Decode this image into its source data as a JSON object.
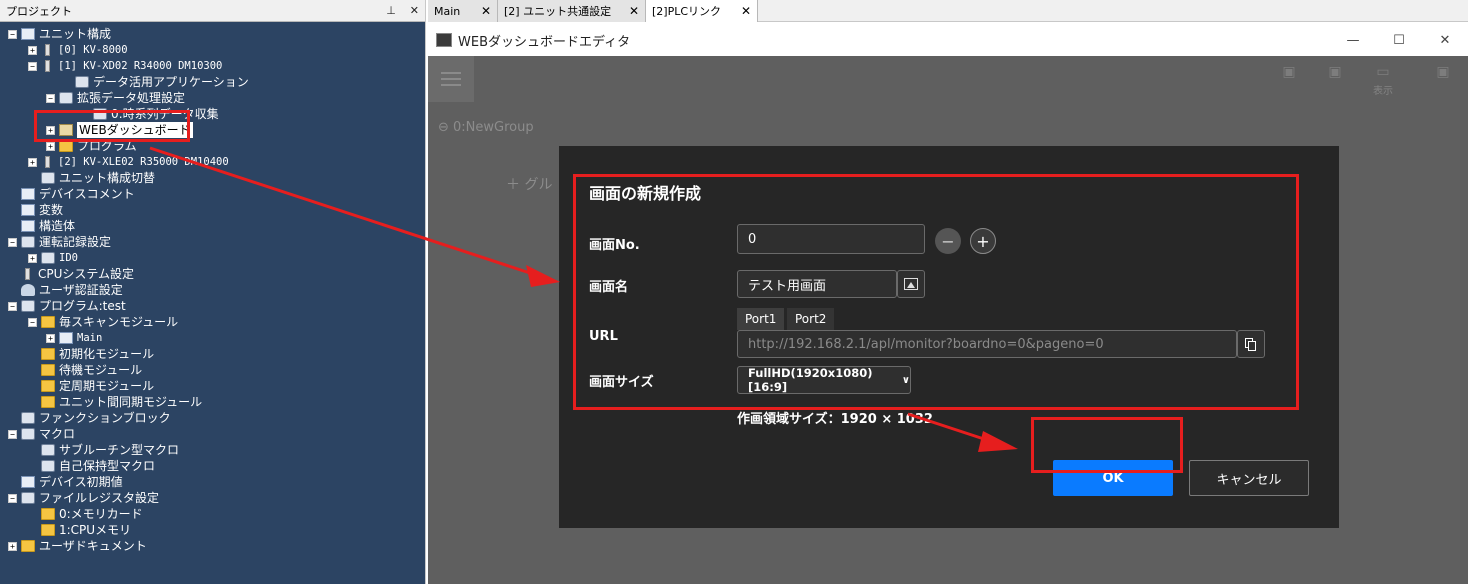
{
  "project_panel": {
    "title": "プロジェクト",
    "pin_icon": "pin-icon",
    "close_icon": "close-icon",
    "tree": [
      {
        "label": "ユニット構成",
        "exp": "-",
        "icon": "unit-config-icon",
        "mono": false
      },
      {
        "label": "[0]  KV-8000",
        "exp": "+",
        "icon": "unit-icon",
        "mono": true
      },
      {
        "label": "[1]  KV-XD02    R34000  DM10300",
        "exp": "-",
        "icon": "unit-icon",
        "mono": true
      },
      {
        "label": "データ活用アプリケーション",
        "exp": "",
        "icon": "gear-icon",
        "mono": false
      },
      {
        "label": "拡張データ処理設定",
        "exp": "-",
        "icon": "gear-icon",
        "mono": false
      },
      {
        "label": "0:時系列データ収集",
        "exp": "",
        "icon": "gear-icon",
        "mono": false
      },
      {
        "label": "WEBダッシュボード",
        "exp": "+",
        "icon": "dashboard-icon",
        "mono": false,
        "highlight": true
      },
      {
        "label": "プログラム",
        "exp": "+",
        "icon": "folder-icon",
        "mono": false
      },
      {
        "label": "[2]  KV-XLE02   R35000  DM10400",
        "exp": "+",
        "icon": "unit-icon",
        "mono": true
      },
      {
        "label": "ユニット構成切替",
        "exp": "",
        "icon": "switch-icon",
        "mono": false
      },
      {
        "label": "デバイスコメント",
        "exp": "",
        "icon": "sheet-icon",
        "mono": false
      },
      {
        "label": "変数",
        "exp": "",
        "icon": "sheet-icon",
        "mono": false
      },
      {
        "label": "構造体",
        "exp": "",
        "icon": "sheet-icon",
        "mono": false
      },
      {
        "label": "運転記録設定",
        "exp": "-",
        "icon": "gear-icon",
        "mono": false
      },
      {
        "label": "ID0",
        "exp": "+",
        "icon": "gear-icon",
        "mono": true
      },
      {
        "label": "CPUシステム設定",
        "exp": "",
        "icon": "unit-icon",
        "mono": false
      },
      {
        "label": "ユーザ認証設定",
        "exp": "",
        "icon": "user-icon",
        "mono": false
      },
      {
        "label": "プログラム:test",
        "exp": "-",
        "icon": "gear-icon",
        "mono": false
      },
      {
        "label": "毎スキャンモジュール",
        "exp": "-",
        "icon": "folder-icon",
        "mono": false
      },
      {
        "label": "Main",
        "exp": "+",
        "icon": "sheet-icon",
        "mono": true
      },
      {
        "label": "初期化モジュール",
        "exp": "",
        "icon": "folder-icon",
        "mono": false
      },
      {
        "label": "待機モジュール",
        "exp": "",
        "icon": "folder-icon",
        "mono": false
      },
      {
        "label": "定周期モジュール",
        "exp": "",
        "icon": "folder-icon",
        "mono": false
      },
      {
        "label": "ユニット間同期モジュール",
        "exp": "",
        "icon": "folder-icon",
        "mono": false
      },
      {
        "label": "ファンクションブロック",
        "exp": "",
        "icon": "gear-icon",
        "mono": false
      },
      {
        "label": "マクロ",
        "exp": "-",
        "icon": "gear-icon",
        "mono": false
      },
      {
        "label": "サブルーチン型マクロ",
        "exp": "",
        "icon": "gear-icon",
        "mono": false
      },
      {
        "label": "自己保持型マクロ",
        "exp": "",
        "icon": "gear-icon",
        "mono": false
      },
      {
        "label": "デバイス初期値",
        "exp": "",
        "icon": "sheet-icon",
        "mono": false
      },
      {
        "label": "ファイルレジスタ設定",
        "exp": "-",
        "icon": "gear-icon",
        "mono": false
      },
      {
        "label": "0:メモリカード",
        "exp": "",
        "icon": "folder-icon",
        "mono": false
      },
      {
        "label": "1:CPUメモリ",
        "exp": "",
        "icon": "folder-icon",
        "mono": false
      },
      {
        "label": "ユーザドキュメント",
        "exp": "+",
        "icon": "folder-icon",
        "mono": false
      }
    ]
  },
  "tabs": [
    {
      "label": "Main",
      "active": false
    },
    {
      "label": "[2] ユニット共通設定",
      "active": false
    },
    {
      "label": "[2]PLCリンク",
      "active": true
    }
  ],
  "editor": {
    "title": "WEBダッシュボードエディタ",
    "minimize": "—",
    "maximize": "☐",
    "close": "✕",
    "toolbar": [
      {
        "label": ""
      },
      {
        "label": ""
      },
      {
        "label": "表示"
      },
      {
        "label": ""
      }
    ],
    "group_label": "0:NewGroup",
    "add_group": "＋  グル"
  },
  "dialog": {
    "title": "画面の新規作成",
    "screen_no_label": "画面No.",
    "screen_no_value": "0",
    "screen_name_label": "画面名",
    "screen_name_value": "テスト用画面",
    "url_label": "URL",
    "port_tabs": [
      "Port1",
      "Port2"
    ],
    "url_value": "http://192.168.2.1/apl/monitor?boardno=0&pageno=0",
    "screen_size_label": "画面サイズ",
    "screen_size_value": "FullHD(1920x1080)[16:9]",
    "area_size": "作画領域サイズ：1920 × 1032",
    "ok": "OK",
    "cancel": "キャンセル"
  },
  "annotation_color": "#e61e1e"
}
